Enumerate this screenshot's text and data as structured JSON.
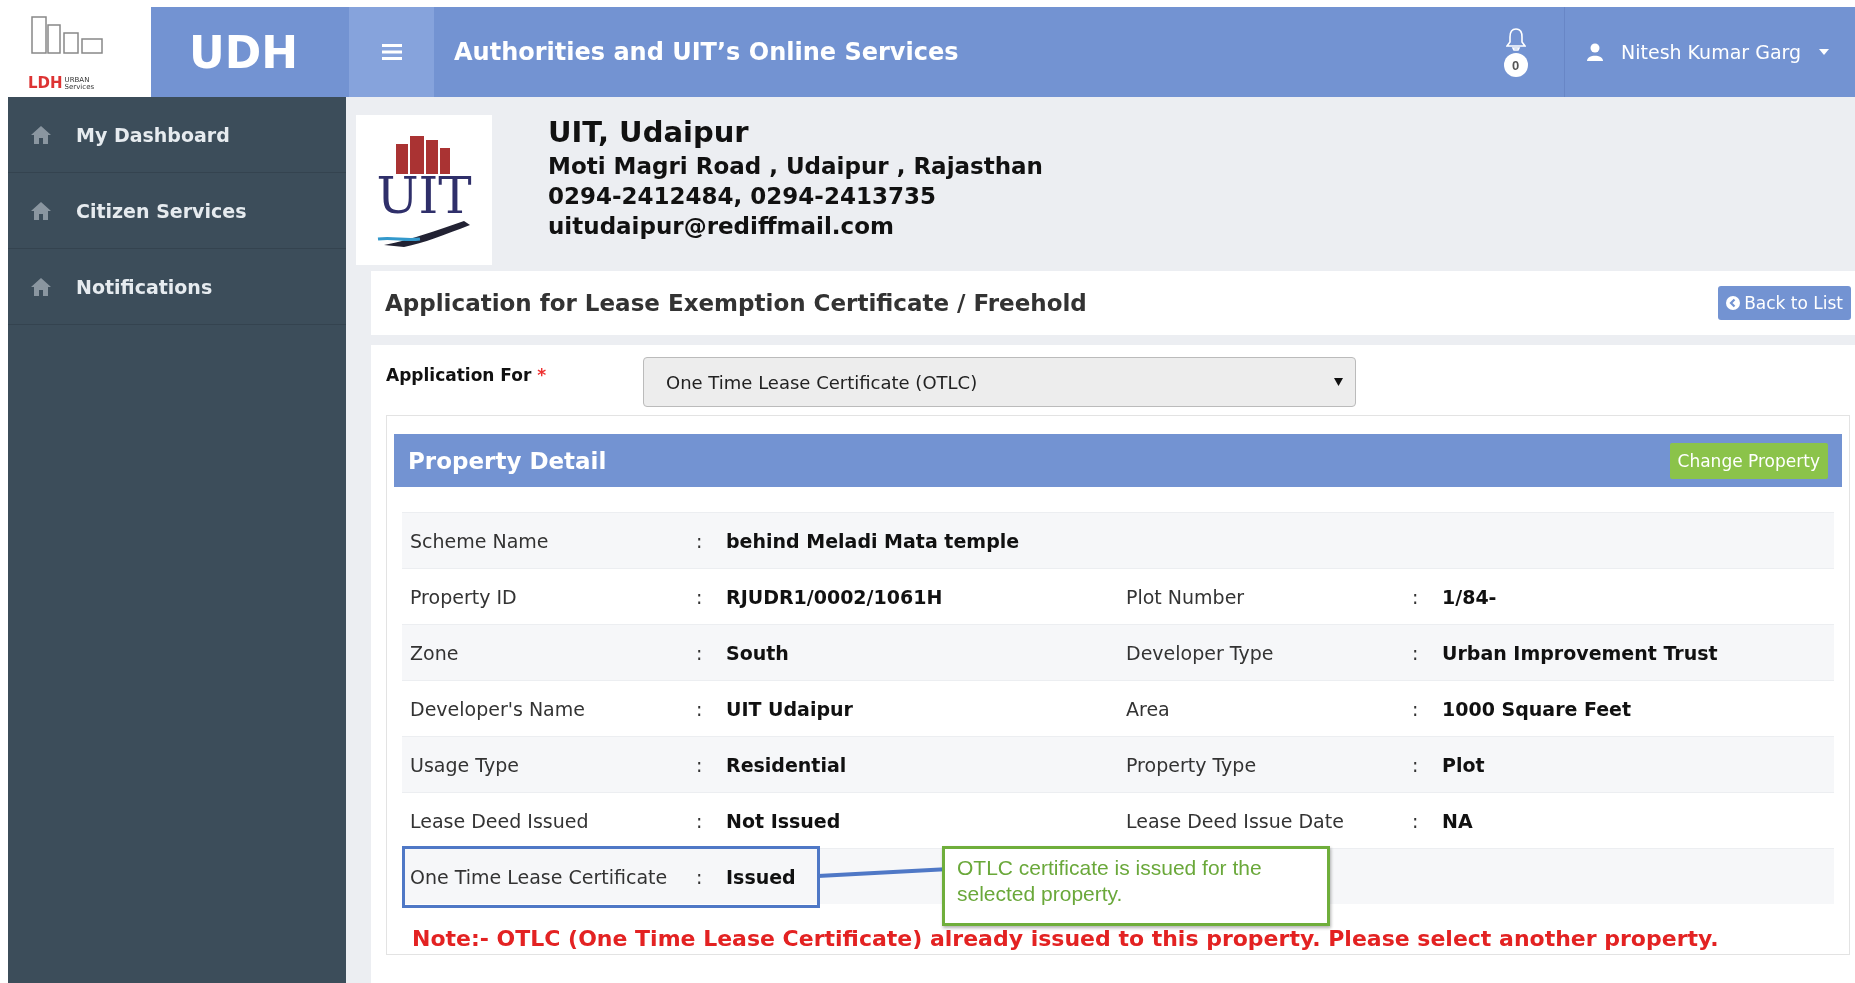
{
  "header": {
    "logo": {
      "mark": "LDH",
      "sub": "URBAN Services"
    },
    "brand": "UDH",
    "title": "Authorities and UIT’s Online Services",
    "notification_count": "0",
    "user": "Nitesh Kumar Garg"
  },
  "sidebar": {
    "items": [
      {
        "label": "My Dashboard"
      },
      {
        "label": "Citizen Services"
      },
      {
        "label": "Notifications"
      }
    ]
  },
  "org": {
    "logo_text": "UIT",
    "name": "UIT, Udaipur",
    "address": "Moti Magri Road , Udaipur , Rajasthan",
    "phones": "0294-2412484, 0294-2413735",
    "email": "uitudaipur@rediffmail.com"
  },
  "page": {
    "title": "Application for Lease Exemption Certificate / Freehold",
    "back_button": "Back to List"
  },
  "form": {
    "label": "Application For",
    "required_mark": "*",
    "value": "One Time Lease Certificate (OTLC)"
  },
  "property_detail": {
    "title": "Property Detail",
    "change_button": "Change Property",
    "separator": ":",
    "rows": [
      {
        "highlighted": false,
        "cells": [
          {
            "label": "Scheme Name",
            "value": "behind Meladi Mata temple"
          }
        ]
      },
      {
        "highlighted": false,
        "cells": [
          {
            "label": "Property ID",
            "value": "RJUDR1/0002/1061H"
          },
          {
            "label": "Plot Number",
            "value": "1/84-"
          }
        ]
      },
      {
        "highlighted": false,
        "cells": [
          {
            "label": "Zone",
            "value": "South"
          },
          {
            "label": "Developer Type",
            "value": "Urban Improvement Trust"
          }
        ]
      },
      {
        "highlighted": false,
        "cells": [
          {
            "label": "Developer's Name",
            "value": "UIT Udaipur"
          },
          {
            "label": "Area",
            "value": "1000 Square Feet"
          }
        ]
      },
      {
        "highlighted": false,
        "cells": [
          {
            "label": "Usage Type",
            "value": "Residential"
          },
          {
            "label": "Property Type",
            "value": "Plot"
          }
        ]
      },
      {
        "highlighted": false,
        "cells": [
          {
            "label": "Lease Deed Issued",
            "value": "Not Issued"
          },
          {
            "label": "Lease Deed Issue Date",
            "value": "NA"
          }
        ]
      },
      {
        "highlighted": true,
        "cells": [
          {
            "label": "One Time Lease Certificate",
            "value": "Issued"
          }
        ]
      }
    ],
    "callout": "OTLC certificate is issued for the selected property.",
    "note": "Note:- OTLC (One Time Lease Certificate) already issued to this property. Please select another property."
  }
}
